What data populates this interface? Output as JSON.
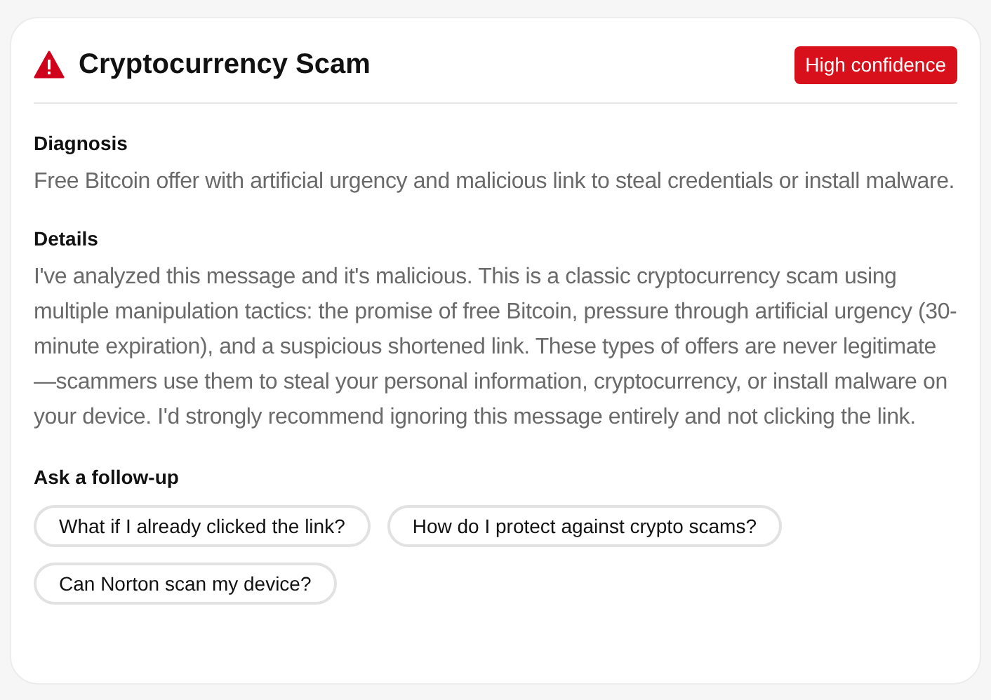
{
  "card": {
    "title": "Cryptocurrency Scam",
    "badge": "High confidence"
  },
  "sections": [
    {
      "heading": "Diagnosis",
      "text": "Free Bitcoin offer with artificial urgency and malicious link to steal credentials or install malware."
    },
    {
      "heading": "Details",
      "text": "I've analyzed this message and it's malicious. This is a classic cryptocurrency scam using multiple manipulation tactics: the promise of free Bitcoin, pressure through artificial urgency (30-minute expiration), and a suspicious shortened link. These types of offers are never legitimate—scammers use them to steal your personal information, cryptocurrency, or install malware on your device. I'd strongly recommend ignoring this message entirely and not clicking the link."
    }
  ],
  "follow_up": {
    "heading": "Ask a follow-up",
    "suggestions": [
      "What if I already clicked the link?",
      "How do I protect against crypto scams?",
      "Can Norton scan my device?"
    ]
  }
}
